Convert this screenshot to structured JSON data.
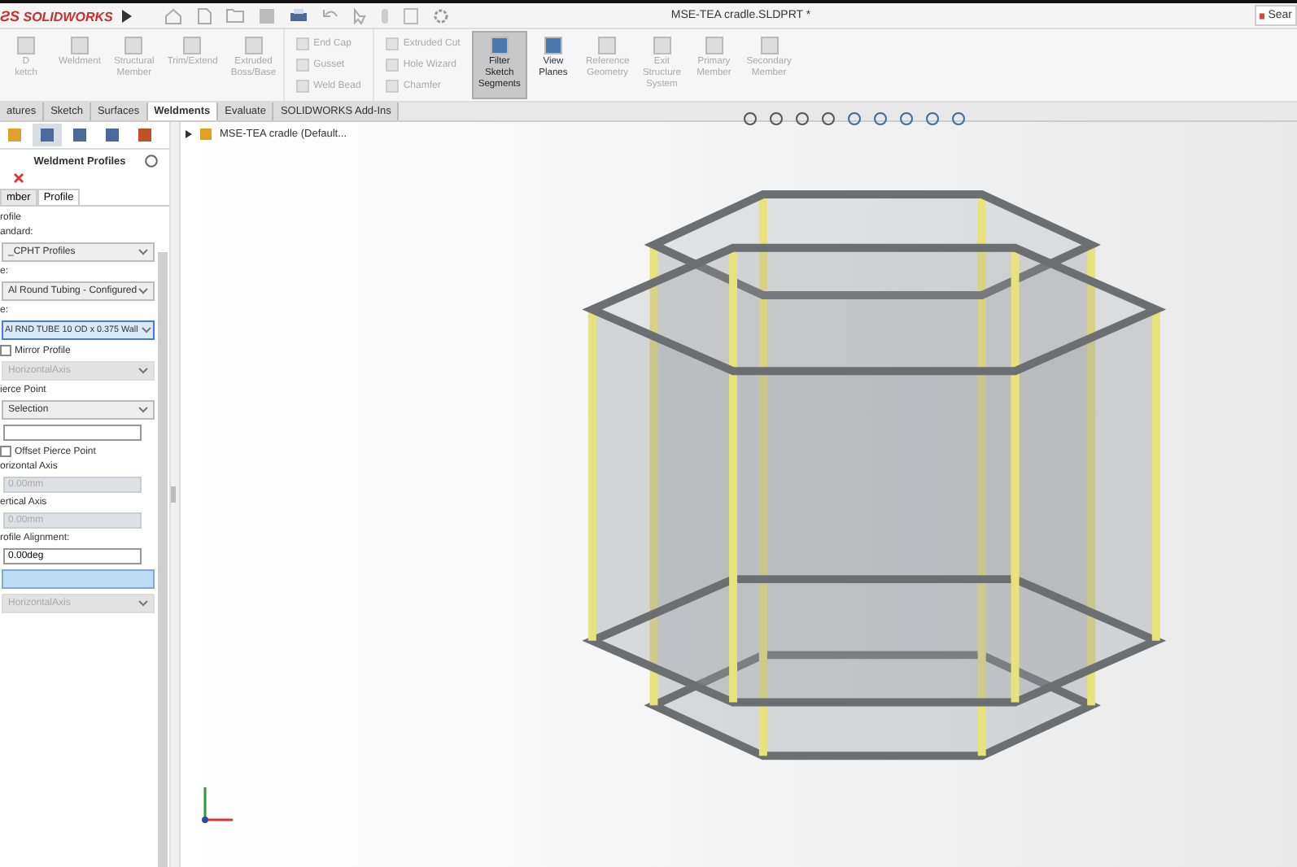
{
  "title_bar": {
    "logo_mark": "ƧS",
    "logo": "SOLIDWORKS",
    "title": "MSE-TEA cradle.SLDPRT *",
    "search": "Sear"
  },
  "ribbon": [
    {
      "kind": "large",
      "lines": [
        "D",
        "ketch"
      ],
      "disabled": true,
      "selected": false
    },
    {
      "kind": "large",
      "lines": [
        "Weldment"
      ],
      "disabled": true,
      "selected": false
    },
    {
      "kind": "large",
      "lines": [
        "Structural",
        "Member"
      ],
      "disabled": true,
      "selected": false
    },
    {
      "kind": "large",
      "lines": [
        "Trim/Extend"
      ],
      "disabled": true,
      "selected": false
    },
    {
      "kind": "large",
      "lines": [
        "Extruded",
        "Boss/Base"
      ],
      "disabled": true,
      "selected": false
    },
    {
      "kind": "stack",
      "lines": [
        "End Cap",
        "Gusset",
        "Weld Bead"
      ],
      "disabled": true,
      "selected": false
    },
    {
      "kind": "stack",
      "lines": [
        "Extruded Cut",
        "Hole Wizard",
        "Chamfer"
      ],
      "disabled": true,
      "selected": false
    },
    {
      "kind": "large",
      "lines": [
        "Filter",
        "Sketch",
        "Segments"
      ],
      "disabled": false,
      "selected": true
    },
    {
      "kind": "large",
      "lines": [
        "View",
        "Planes"
      ],
      "disabled": false,
      "selected": false
    },
    {
      "kind": "large",
      "lines": [
        "Reference",
        "Geometry"
      ],
      "disabled": true,
      "selected": false
    },
    {
      "kind": "large",
      "lines": [
        "Exit",
        "Structure",
        "System"
      ],
      "disabled": true,
      "selected": false
    },
    {
      "kind": "large",
      "lines": [
        "Primary",
        "Member"
      ],
      "disabled": true,
      "selected": false
    },
    {
      "kind": "large",
      "lines": [
        "Secondary",
        "Member"
      ],
      "disabled": true,
      "selected": false
    }
  ],
  "tabs": [
    {
      "label": "atures",
      "selected": false
    },
    {
      "label": "Sketch",
      "selected": false
    },
    {
      "label": "Surfaces",
      "selected": false
    },
    {
      "label": "Weldments",
      "selected": true
    },
    {
      "label": "Evaluate",
      "selected": false
    },
    {
      "label": "SOLIDWORKS Add-Ins",
      "selected": false
    }
  ],
  "panel": {
    "title": "Weldment Profiles",
    "subtabs": [
      {
        "label": "mber",
        "selected": false
      },
      {
        "label": "Profile",
        "selected": true
      }
    ],
    "fields": [
      {
        "kind": "label",
        "text": "rofile"
      },
      {
        "kind": "label",
        "text": "andard:"
      },
      {
        "kind": "select",
        "text": "_CPHT Profiles",
        "disabled": false,
        "selected": false
      },
      {
        "kind": "label",
        "text": "e:"
      },
      {
        "kind": "select",
        "text": "Al Round Tubing - Configured",
        "disabled": false,
        "selected": false
      },
      {
        "kind": "label",
        "text": "e:"
      },
      {
        "kind": "select",
        "text": "Al RND TUBE 10 OD x 0.375 Wall",
        "disabled": false,
        "selected": true
      },
      {
        "kind": "checkbox",
        "text": "Mirror Profile",
        "checked": false
      },
      {
        "kind": "select",
        "text": "HorizontalAxis",
        "disabled": true,
        "selected": false
      },
      {
        "kind": "label",
        "text": "ierce Point"
      },
      {
        "kind": "select",
        "text": "Selection",
        "disabled": false,
        "selected": false
      },
      {
        "kind": "input",
        "disabled": false
      },
      {
        "kind": "checkbox",
        "text": "Offset Pierce Point",
        "checked": false
      },
      {
        "kind": "label",
        "text": "orizontal Axis"
      },
      {
        "kind": "input",
        "text": "0.00mm",
        "disabled": true
      },
      {
        "kind": "label",
        "text": "ertical Axis"
      },
      {
        "kind": "input",
        "text": "0.00mm",
        "disabled": true
      },
      {
        "kind": "label",
        "text": "rofile Alignment:"
      },
      {
        "kind": "input",
        "text": "0.00deg",
        "disabled": false
      },
      {
        "kind": "listbox"
      },
      {
        "kind": "select",
        "text": "HorizontalAxis",
        "disabled": true,
        "selected": false
      }
    ]
  },
  "tree": {
    "label": "MSE-TEA cradle  (Default..."
  }
}
